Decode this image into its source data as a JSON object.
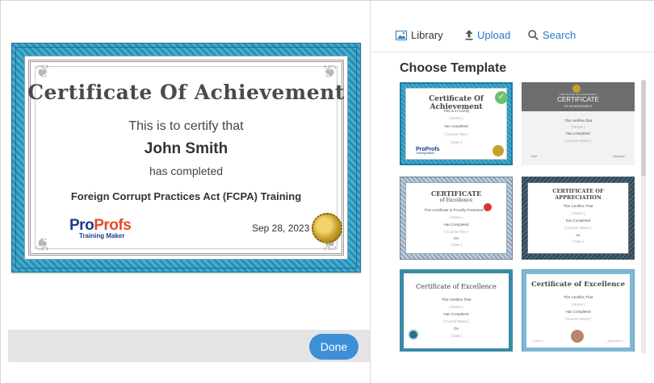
{
  "certificate": {
    "title": "Certificate Of Achievement",
    "certify_text": "This is to certify that",
    "recipient_name": "John Smith",
    "completed_text": "has completed",
    "course_name": "Foreign Corrupt Practices Act (FCPA) Training",
    "logo_text_pro": "Pro",
    "logo_text_profs": "Profs",
    "logo_subtext": "Training Maker",
    "date": "Sep 28, 2023"
  },
  "actions": {
    "done_label": "Done"
  },
  "tabs": [
    {
      "label": "Library",
      "icon": "image-icon",
      "active": true
    },
    {
      "label": "Upload",
      "icon": "upload-icon",
      "active": false
    },
    {
      "label": "Search",
      "icon": "search-icon",
      "active": false
    }
  ],
  "panel": {
    "title": "Choose Template"
  },
  "templates": [
    {
      "title": "Certificate Of Achievement",
      "lines": [
        "This is to Certify",
        "[ Name ]",
        "has completed",
        "[ Course Title ]",
        "[ Date ]"
      ],
      "selected": true,
      "logo": "ProProfs",
      "logo_sub": "Training Maker"
    },
    {
      "title": "CERTIFICATE",
      "subtitle": "OF ACHIEVEMENT",
      "header": "CERTIFICATE OF ACHIEVEMENT",
      "lines": [
        "This certifies that",
        "[ Name ]",
        "has completed",
        "[ Course Name ]"
      ],
      "footer_left": "Date",
      "footer_right": "Signature"
    },
    {
      "title": "CERTIFICATE",
      "subtitle": "of Excellence",
      "lines": [
        "This Certificate Is Proudly Presented To",
        "[ Name ]",
        "Has Completed",
        "[ Course Title ]",
        "On",
        "[ Date ]"
      ]
    },
    {
      "title": "CERTIFICATE OF",
      "subtitle": "APPRECIATION",
      "lines": [
        "This Certifies That",
        "[ Name ]",
        "has Completed",
        "[ Course Name ]",
        "on",
        "[ Date ]"
      ]
    },
    {
      "title": "Certificate of Excellence",
      "lines": [
        "This Certifies That",
        "[ Name ]",
        "Has Completed",
        "[ Course Name ]",
        "On",
        "[ Date ]"
      ]
    },
    {
      "title": "Certificate of Excellence",
      "lines": [
        "This Certifies That",
        "[ Name ]",
        "Has Completed",
        "[ Course Name ]"
      ],
      "footer_left": "[ Date ]",
      "footer_right": "[ Signature ]"
    }
  ],
  "colors": {
    "accent": "#3d8fd6",
    "link": "#2a7bc4",
    "frame_blue": "#2a8fb4",
    "check_green": "#6cc36f"
  }
}
